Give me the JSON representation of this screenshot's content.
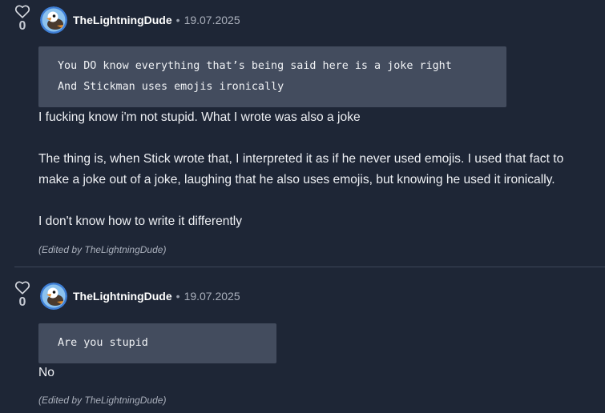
{
  "comments": [
    {
      "likes": "0",
      "username": "TheLightningDude",
      "separator": "•",
      "date": "19.07.2025",
      "quote_lines": [
        "You DO know everything that’s being said here is a joke right",
        "And Stickman uses emojis ironically"
      ],
      "body_lines": [
        "I fucking know i'm not stupid. What I wrote was also a joke",
        "The thing is, when Stick wrote that, I interpreted it as if he never used emojis. I used that fact to",
        "make a joke out of a joke, laughing that he also uses emojis, but knowing he used it ironically.",
        "I don't know how to write it differently"
      ],
      "edited_note": "(Edited by TheLightningDude)"
    },
    {
      "likes": "0",
      "username": "TheLightningDude",
      "separator": "•",
      "date": "19.07.2025",
      "quote_lines": [
        "Are you stupid"
      ],
      "body_lines": [
        "No"
      ],
      "edited_note": "(Edited by TheLightningDude)"
    }
  ],
  "icons": {
    "like": "heart-outline-icon",
    "avatar": "duck-avatar"
  },
  "colors": {
    "background": "#1e2636",
    "quote_background": "#434c5e",
    "avatar_ring": "#3f7fd6"
  }
}
